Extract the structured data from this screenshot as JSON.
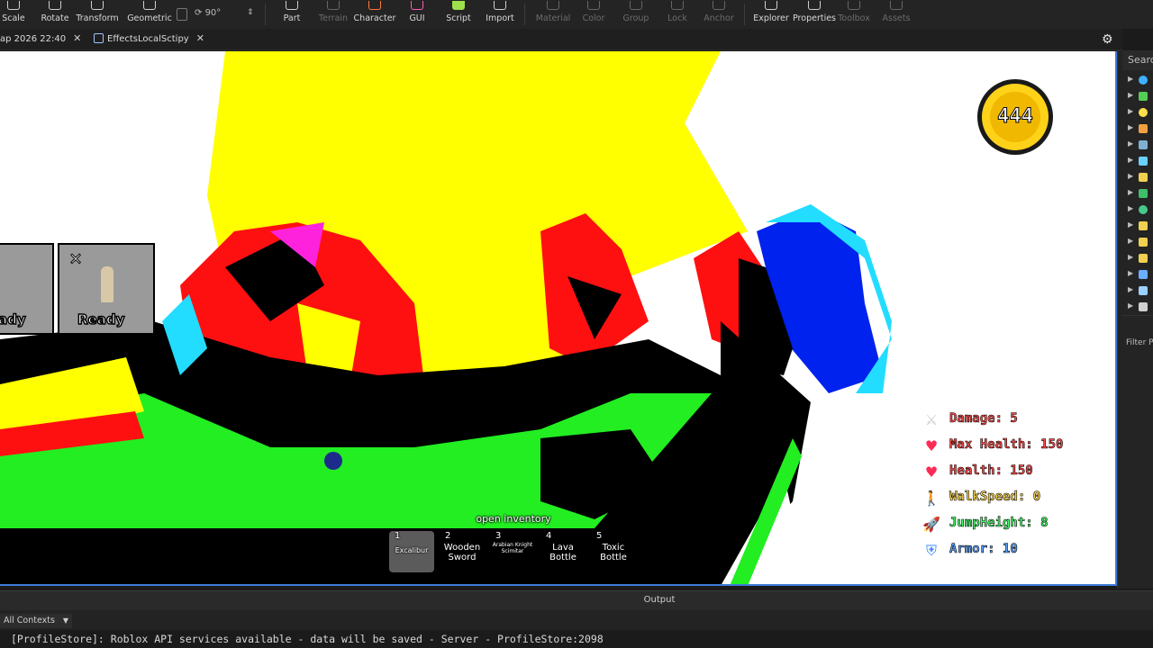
{
  "ribbon": {
    "tools": [
      {
        "label": "Scale",
        "icon": "scale-icon"
      },
      {
        "label": "Rotate",
        "icon": "rotate-icon"
      },
      {
        "label": "Transform",
        "icon": "transform-icon"
      },
      {
        "label": "Geometric",
        "icon": "geometric-icon"
      },
      {
        "label": "Part",
        "icon": "part-icon"
      },
      {
        "label": "Terrain",
        "icon": "terrain-icon"
      },
      {
        "label": "Character",
        "icon": "character-icon"
      },
      {
        "label": "GUI",
        "icon": "gui-icon"
      },
      {
        "label": "Script",
        "icon": "script-icon"
      },
      {
        "label": "Import",
        "icon": "import-icon"
      },
      {
        "label": "Material",
        "icon": "material-icon"
      },
      {
        "label": "Color",
        "icon": "color-icon"
      },
      {
        "label": "Group",
        "icon": "group-icon"
      },
      {
        "label": "Lock",
        "icon": "lock-icon"
      },
      {
        "label": "Anchor",
        "icon": "anchor-icon"
      },
      {
        "label": "Explorer",
        "icon": "explorer-icon"
      },
      {
        "label": "Properties",
        "icon": "properties-icon"
      },
      {
        "label": "Toolbox",
        "icon": "toolbox-icon"
      },
      {
        "label": "Assets",
        "icon": "assets-icon"
      }
    ],
    "rotate_angle": "90°"
  },
  "tabs": [
    {
      "label": "ap 2026 22:40"
    },
    {
      "label": "EffectsLocalSctipy"
    }
  ],
  "explorer": {
    "search_label": "Searc",
    "filter_label": "Filter P"
  },
  "hud": {
    "coins": "444",
    "slots": [
      {
        "label": "ady"
      },
      {
        "label": "Ready"
      }
    ],
    "stats": [
      {
        "icon": "sword-icon",
        "text": "Damage: 5",
        "color": "#ff4a4a",
        "glyph": "⚔"
      },
      {
        "icon": "heart-icon",
        "text": "Max Health: 150",
        "color": "#ff4a4a",
        "glyph": "♥"
      },
      {
        "icon": "heart-icon",
        "text": "Health: 150",
        "color": "#ff4a4a",
        "glyph": "♥"
      },
      {
        "icon": "walk-icon",
        "text": "WalkSpeed: 0",
        "color": "#ffd84a",
        "glyph": "🚶"
      },
      {
        "icon": "rocket-icon",
        "text": "JumpHeight: 8",
        "color": "#47ff6a",
        "glyph": "🚀"
      },
      {
        "icon": "shield-icon",
        "text": "Armor: 10",
        "color": "#5aa0ff",
        "glyph": "⛨"
      }
    ],
    "open_inventory": "open inventory",
    "hotbar": [
      {
        "num": "1",
        "name": "Excalibur"
      },
      {
        "num": "2",
        "name": "Wooden Sword"
      },
      {
        "num": "3",
        "name": "Arabian Knight Scimitar"
      },
      {
        "num": "4",
        "name": "Lava Bottle"
      },
      {
        "num": "5",
        "name": "Toxic Bottle"
      }
    ]
  },
  "output": {
    "title": "Output",
    "context": "All Contexts",
    "log": "[ProfileStore]: Roblox API services available - data will be saved  -  Server - ProfileStore:2098"
  }
}
